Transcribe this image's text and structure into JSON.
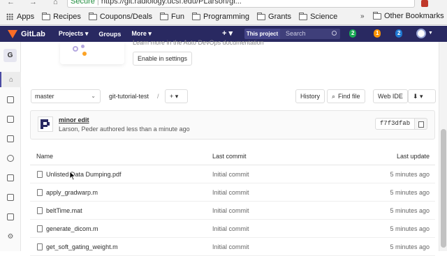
{
  "browser": {
    "url_secure": "Secure",
    "url": "https://git.radiology.ucsf.edu/PLarson/gi...",
    "bookmarks": [
      "Apps",
      "Recipes",
      "Coupons/Deals",
      "Fun",
      "Programming",
      "Grants",
      "Science"
    ],
    "other_bookmarks": "Other Bookmarks",
    "more": "»"
  },
  "gitlab_header": {
    "brand": "GitLab",
    "nav": [
      "Projects ▾",
      "Groups",
      "More ▾"
    ],
    "plus": "+ ▾",
    "this_project": "This project",
    "search_placeholder": "Search",
    "badges": [
      {
        "value": "2",
        "color": "#1aaa55"
      },
      {
        "value": "1",
        "color": "#fc9403"
      },
      {
        "value": "2",
        "color": "#1f78d1"
      }
    ]
  },
  "sidebar": {
    "project_initial": "G"
  },
  "devops": {
    "learn_more": "Learn more in the Auto DevOps documentation",
    "enable_button": "Enable in settings"
  },
  "repo": {
    "branch": "master",
    "project": "git-tutorial-test",
    "separator": "/",
    "add_button": "+ ▾",
    "history": "History",
    "find_file": "Find file",
    "web_ide": "Web IDE",
    "clone_button": "⬇ ▾"
  },
  "commit": {
    "title": "minor edit",
    "meta": "Larson, Peder authored less than a minute ago",
    "sha": "f7f3dfab"
  },
  "table": {
    "headers": {
      "name": "Name",
      "last_commit": "Last commit",
      "last_update": "Last update"
    },
    "rows": [
      {
        "name": "Unlisted Data Dumping.pdf",
        "commit": "Initial commit",
        "updated": "5 minutes ago"
      },
      {
        "name": "apply_gradwarp.m",
        "commit": "Initial commit",
        "updated": "5 minutes ago"
      },
      {
        "name": "beltTime.mat",
        "commit": "Initial commit",
        "updated": "5 minutes ago"
      },
      {
        "name": "generate_dicom.m",
        "commit": "Initial commit",
        "updated": "5 minutes ago"
      },
      {
        "name": "get_soft_gating_weight.m",
        "commit": "Initial commit",
        "updated": "5 minutes ago"
      }
    ]
  },
  "colors": {
    "header_bg": "#292961",
    "gitlab_orange": "#fc6d26"
  }
}
